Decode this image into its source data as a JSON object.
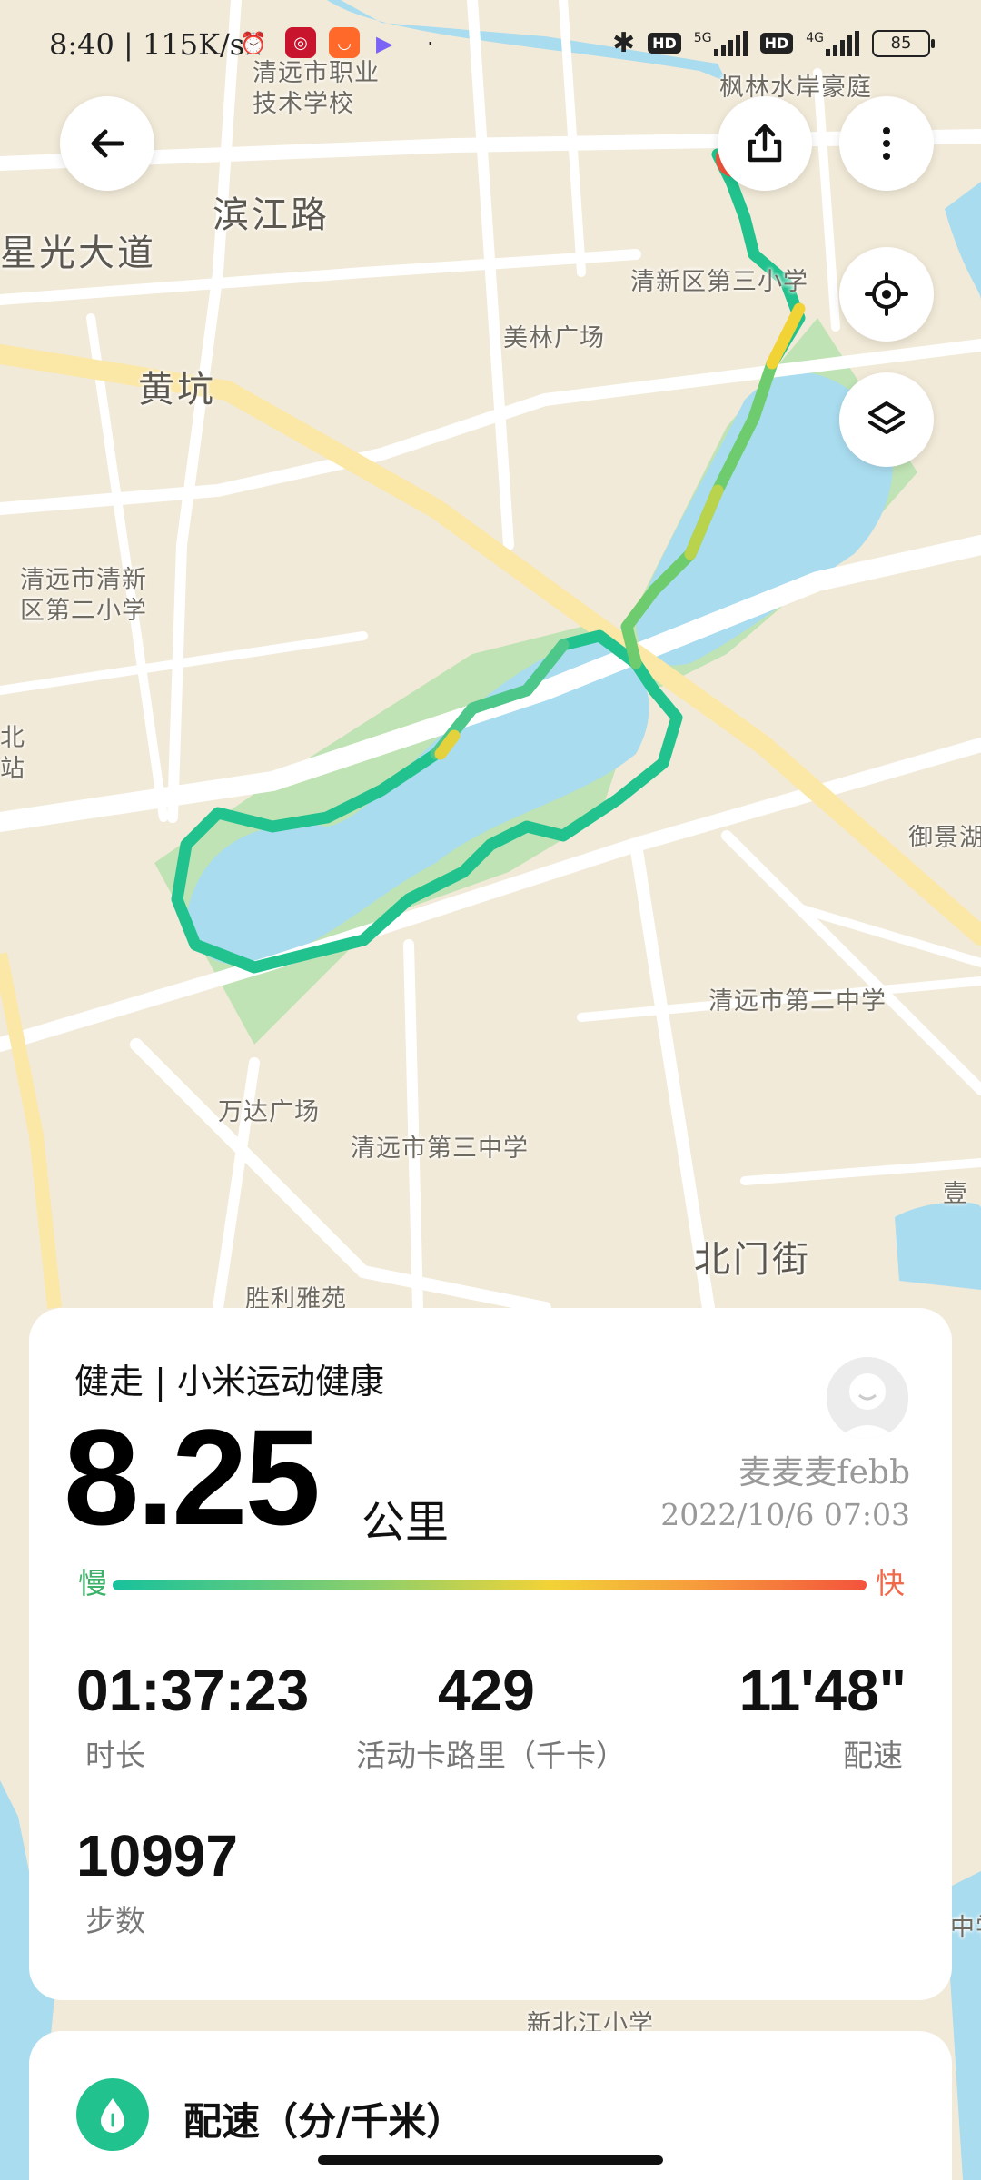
{
  "status_bar": {
    "time": "8:40",
    "net_speed": "115K/s",
    "battery": "85",
    "hd1": "HD",
    "hd2": "HD",
    "net1": "5G",
    "net2": "4G"
  },
  "map": {
    "labels": [
      {
        "text": "清远市职业\n技术学校",
        "cls": "multi"
      },
      {
        "text": "枫林水岸豪庭",
        "cls": ""
      },
      {
        "text": "滨江路",
        "cls": "big"
      },
      {
        "text": "星光大道",
        "cls": "big"
      },
      {
        "text": "清新区第三小学",
        "cls": ""
      },
      {
        "text": "美林广场",
        "cls": ""
      },
      {
        "text": "黄坑",
        "cls": "big"
      },
      {
        "text": "清远市清新\n区第二小学",
        "cls": "multi"
      },
      {
        "text": "北\n站",
        "cls": "multi"
      },
      {
        "text": "御景湖",
        "cls": ""
      },
      {
        "text": "清远市第二中学",
        "cls": ""
      },
      {
        "text": "万达广场",
        "cls": ""
      },
      {
        "text": "清远市第三中学",
        "cls": ""
      },
      {
        "text": "壹",
        "cls": ""
      },
      {
        "text": "北门街",
        "cls": "big"
      },
      {
        "text": "胜利雅苑",
        "cls": ""
      },
      {
        "text": "中学",
        "cls": ""
      },
      {
        "text": "新北江小学",
        "cls": ""
      }
    ],
    "route_colors": {
      "slow": "#18c29c",
      "mid": "#8fcf6a",
      "fast": "#f2d336"
    }
  },
  "buttons": {
    "back": "back-arrow-icon",
    "share": "share-icon",
    "more": "more-vertical-icon",
    "locate": "locate-icon",
    "layers": "layers-icon"
  },
  "workout": {
    "title": "健走 | 小米运动健康",
    "distance": "8.25",
    "distance_unit": "公里",
    "username": "麦麦麦febb",
    "datetime": "2022/10/6 07:03",
    "speed_slow": "慢",
    "speed_fast": "快",
    "stats": [
      {
        "value": "01:37:23",
        "label": "时长"
      },
      {
        "value": "429",
        "label": "活动卡路里（千卡）"
      },
      {
        "value": "11'48\"",
        "label": "配速"
      },
      {
        "value": "10997",
        "label": "步数"
      }
    ]
  },
  "pace_section": {
    "title": "配速（分/千米）"
  }
}
